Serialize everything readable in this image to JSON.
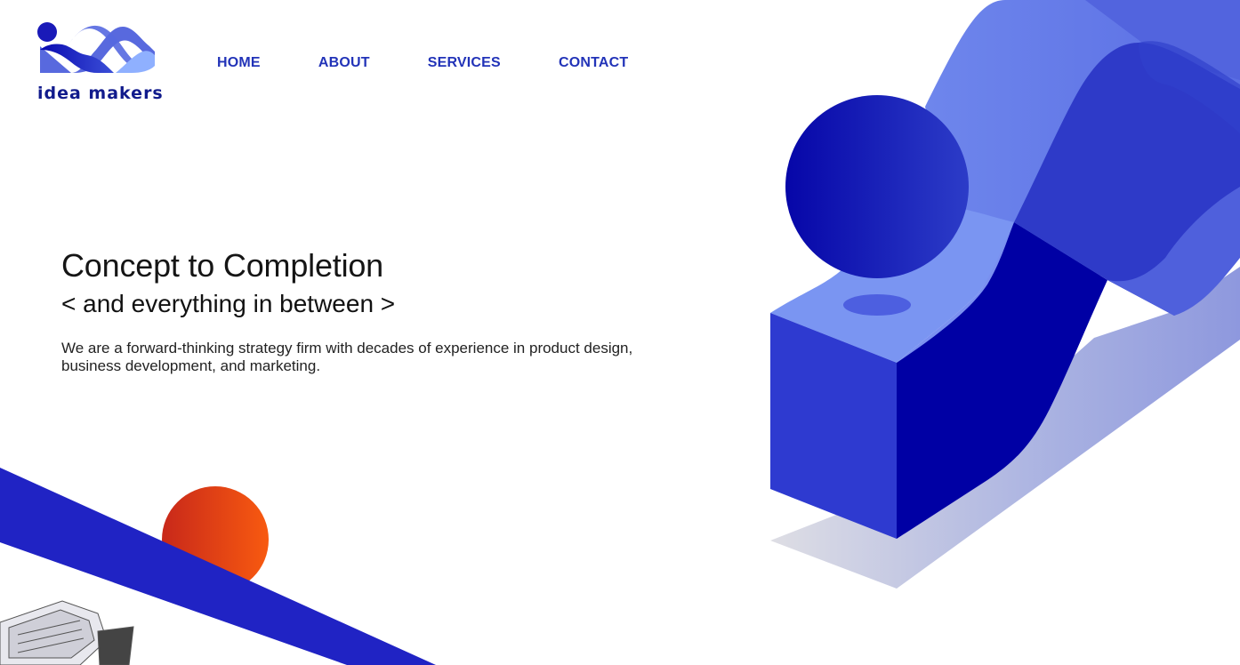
{
  "brand": {
    "name": "idea makers",
    "colors": {
      "primary": "#0a0ab0",
      "mid": "#3b4fd8",
      "light": "#7f9cf5",
      "orange": "#f05a14",
      "nav_text": "#2233b8"
    }
  },
  "nav": {
    "items": [
      {
        "label": "HOME"
      },
      {
        "label": "ABOUT"
      },
      {
        "label": "SERVICES"
      },
      {
        "label": "CONTACT"
      }
    ]
  },
  "hero": {
    "title": "Concept to Completion",
    "subtitle": "< and everything in between >",
    "description": "We are a forward-thinking strategy firm with decades of experience in product design, business development, and marketing."
  }
}
